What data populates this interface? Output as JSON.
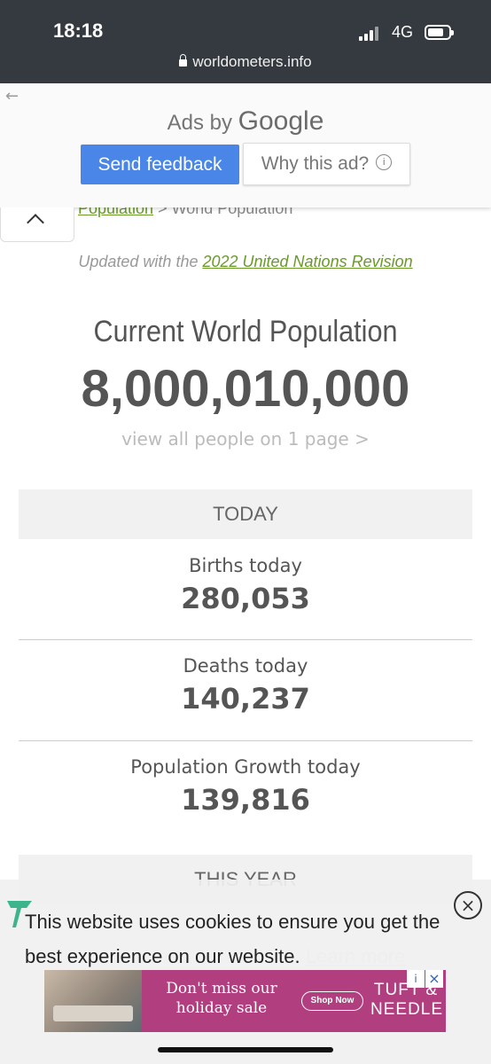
{
  "status_bar": {
    "time": "18:18",
    "network": "4G"
  },
  "browser": {
    "url": "worldometers.info"
  },
  "ad_panel": {
    "ads_by": "Ads by",
    "google": "Google",
    "send_feedback": "Send feedback",
    "why_this_ad": "Why this ad?"
  },
  "breadcrumb": {
    "link": "Population",
    "separator": " > ",
    "current": "World Population"
  },
  "updated": {
    "prefix": "Updated with the ",
    "link": "2022 United Nations Revision"
  },
  "main": {
    "title": "Current World Population",
    "counter": "8,000,010,000",
    "view_all": "view all people on 1 page >"
  },
  "today": {
    "heading": "TODAY",
    "stats": [
      {
        "label": "Births today",
        "value": "280,053"
      },
      {
        "label": "Deaths today",
        "value": "140,237"
      },
      {
        "label": "Population Growth today",
        "value": "139,816"
      }
    ]
  },
  "this_year": {
    "heading": "THIS YEAR"
  },
  "cookie": {
    "text": "This website uses cookies to ensure you get the best experience on our website.",
    "learn_more": "Learn more"
  },
  "bottom_ad": {
    "headline": "Don't miss our holiday sale",
    "cta": "Shop Now",
    "brand": "TUFT & NEEDLE"
  },
  "colors": {
    "status_bar": "#353a40",
    "accent_green": "#6a9a2a",
    "feedback_blue": "#4a86e8",
    "ad_bg": "#b13f7f"
  }
}
